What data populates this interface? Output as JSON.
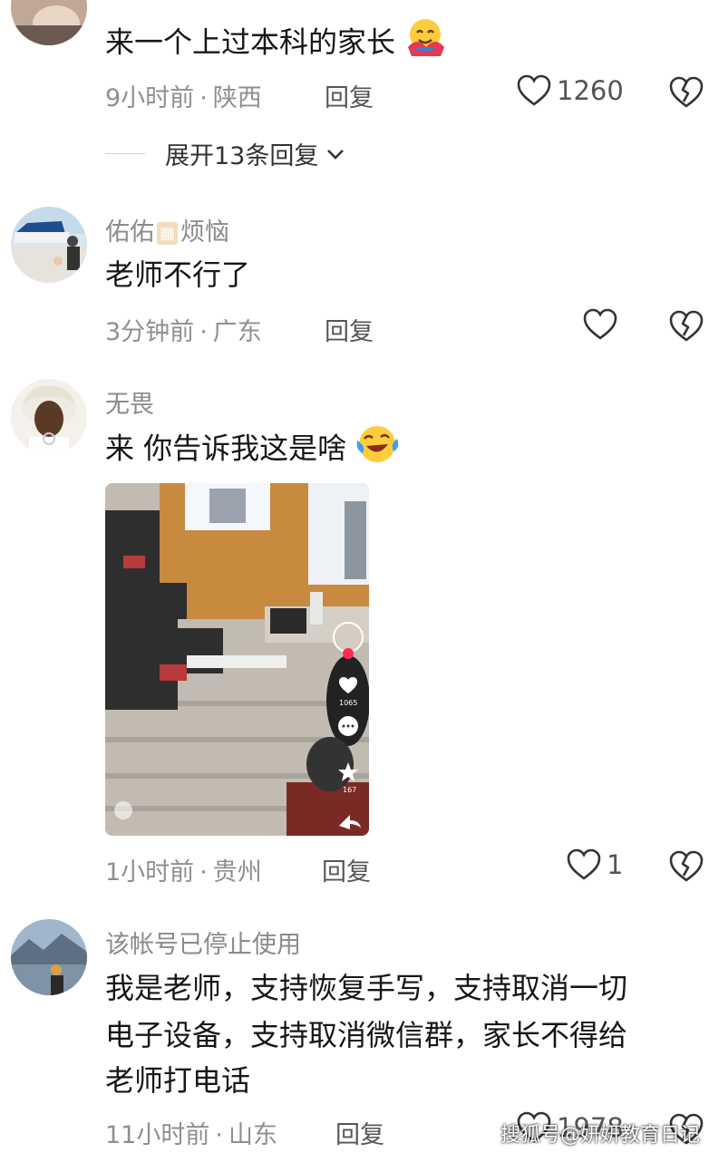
{
  "comments": [
    {
      "text": "来一个上过本科的家长",
      "time": "9小时前",
      "location": "陕西",
      "reply_label": "回复",
      "likes": "1260",
      "expand_label": "展开13条回复"
    },
    {
      "username": "佑佑",
      "username_suffix": "烦恼",
      "text": "老师不行了",
      "time": "3分钟前",
      "location": "广东",
      "reply_label": "回复"
    },
    {
      "username": "无畏",
      "text": "来 你告诉我这是啥",
      "time": "1小时前",
      "location": "贵州",
      "reply_label": "回复",
      "likes": "1",
      "video": {
        "likes": "1065",
        "comments": "",
        "favorites": "167"
      }
    },
    {
      "username": "该帐号已停止使用",
      "text_lines": [
        "我是老师，支持恢复手写，支持取消一切",
        "电子设备，支持取消微信群，家长不得给",
        "老师打电话"
      ],
      "time": "11小时前",
      "location": "山东",
      "reply_label": "回复",
      "likes": "1978"
    }
  ],
  "separator": "·",
  "watermark": "搜狐号@妍妍教育日记",
  "colors": {
    "text": "#161616",
    "meta": "#8f8f8f",
    "accent_red": "#fe2c55"
  }
}
